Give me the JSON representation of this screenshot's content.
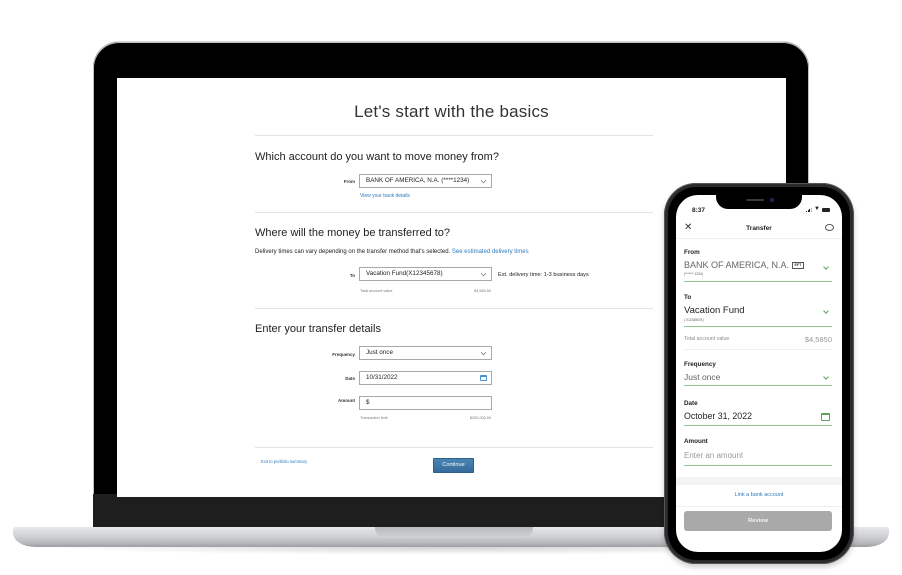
{
  "desktop": {
    "page_title": "Let's start with the basics",
    "from_section": {
      "heading": "Which account do you want to move money from?",
      "from_label": "From",
      "from_value": "BANK OF AMERICA, N.A. (****1234)",
      "bank_details_link": "View your bank details"
    },
    "to_section": {
      "heading": "Where will the money be transferred to?",
      "delivery_note": "Delivery times can vary depending on the transfer method that's selected.",
      "delivery_link": "See estimated delivery times",
      "to_label": "To",
      "to_value": "Vacation Fund(X12345678)",
      "delivery_estimate": "Est. delivery time: 1-3 business days",
      "total_label": "Total account value",
      "total_value": "$4,585.50"
    },
    "details_section": {
      "heading": "Enter your transfer details",
      "frequency_label": "Frequency",
      "frequency_value": "Just once",
      "date_label": "Date",
      "date_value": "10/31/2022",
      "amount_label": "Amount",
      "amount_prefix": "$",
      "limit_label": "Transaction limit",
      "limit_value": "$250,000.00"
    },
    "footer": {
      "exit_link": "Exit to portfolio summary",
      "continue_button": "Continue"
    }
  },
  "mobile": {
    "status_time": "8:37",
    "header_title": "Transfer",
    "from_label": "From",
    "from_value": "BANK OF AMERICA, N.A.",
    "from_badge": "EFT",
    "from_sub": "(******* 1234)",
    "to_label": "To",
    "to_value": "Vacation Fund",
    "to_sub": "( X12345678 )",
    "total_label": "Total account value",
    "total_value": "$4,5850",
    "frequency_label": "Frequency",
    "frequency_value": "Just once",
    "date_label": "Date",
    "date_value": "October 31, 2022",
    "amount_label": "Amount",
    "amount_placeholder": "Enter an amount",
    "link_bank": "Link a bank account",
    "review_button": "Review"
  },
  "colors": {
    "link": "#2f7bbf",
    "primary_button": "#3f78a8",
    "mobile_accent": "#5aa55a",
    "disabled_button": "#a9a9a9"
  }
}
